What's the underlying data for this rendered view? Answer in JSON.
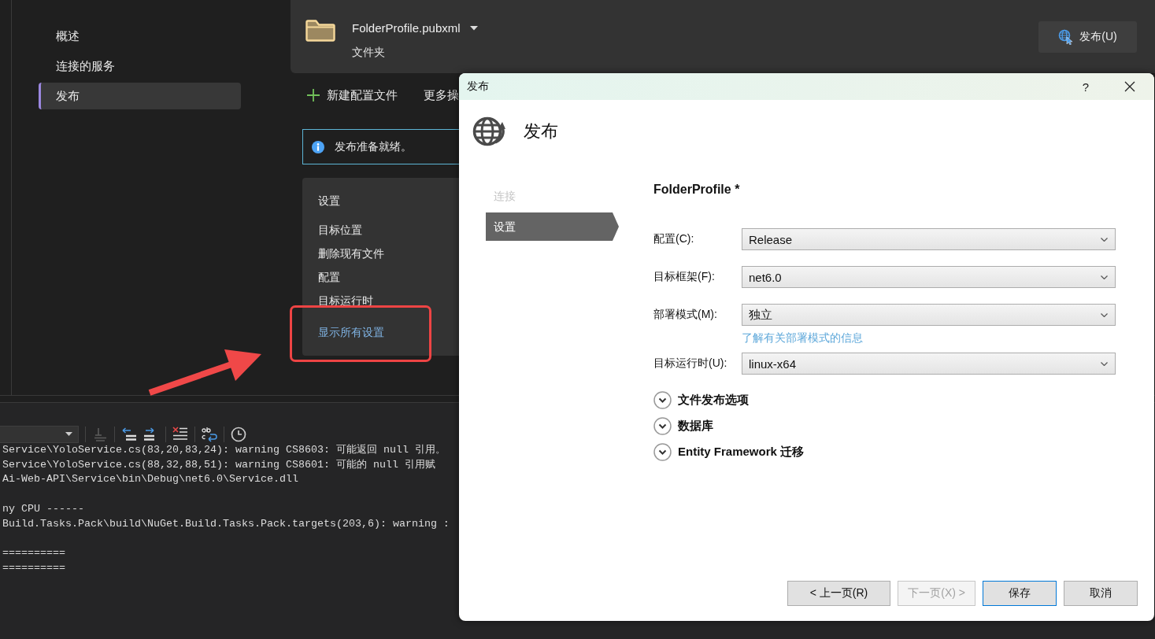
{
  "left_nav": {
    "items": [
      {
        "label": "概述",
        "selected": false
      },
      {
        "label": "连接的服务",
        "selected": false
      },
      {
        "label": "发布",
        "selected": true
      }
    ]
  },
  "profile_header": {
    "profile_name": "FolderProfile.pubxml",
    "profile_type": "文件夹",
    "publish_button": "发布(U)"
  },
  "actions": {
    "new_profile": "新建配置文件",
    "more_actions": "更多操"
  },
  "info_bar": {
    "message": "发布准备就绪。"
  },
  "settings_card": {
    "title": "设置",
    "items": [
      "目标位置",
      "删除现有文件",
      "配置",
      "目标运行时"
    ],
    "show_all_link": "显示所有设置"
  },
  "output_panel": {
    "blocks": [
      [
        "Service\\YoloService.cs(83,20,83,24): warning CS8603: 可能返回 null 引用。",
        "Service\\YoloService.cs(88,32,88,51): warning CS8601: 可能的 null 引用赋",
        "Ai-Web-API\\Service\\bin\\Debug\\net6.0\\Service.dll"
      ],
      [
        "ny CPU ------",
        "Build.Tasks.Pack\\build\\NuGet.Build.Tasks.Pack.targets(203,6): warning :"
      ],
      [
        "==========",
        "=========="
      ]
    ]
  },
  "dialog": {
    "title": "发布",
    "help_button": "?",
    "heading": "发布",
    "steps": [
      {
        "label": "连接",
        "selected": false,
        "disabled": true
      },
      {
        "label": "设置",
        "selected": true,
        "disabled": false
      }
    ],
    "profile_title": "FolderProfile *",
    "fields": [
      {
        "label": "配置(C):",
        "value": "Release"
      },
      {
        "label": "目标框架(F):",
        "value": "net6.0"
      },
      {
        "label": "部署模式(M):",
        "value": "独立",
        "help_link": "了解有关部署模式的信息"
      },
      {
        "label": "目标运行时(U):",
        "value": "linux-x64"
      }
    ],
    "sections": [
      {
        "label": "文件发布选项",
        "expanded": false
      },
      {
        "label": "数据库",
        "expanded": false
      },
      {
        "label": "Entity Framework 迁移",
        "expanded": false
      }
    ],
    "buttons": [
      {
        "label": "< 上一页(R)",
        "disabled": false,
        "default": false
      },
      {
        "label": "下一页(X) >",
        "disabled": true,
        "default": false
      },
      {
        "label": "保存",
        "disabled": false,
        "default": true
      },
      {
        "label": "取消",
        "disabled": false,
        "default": false
      }
    ]
  }
}
